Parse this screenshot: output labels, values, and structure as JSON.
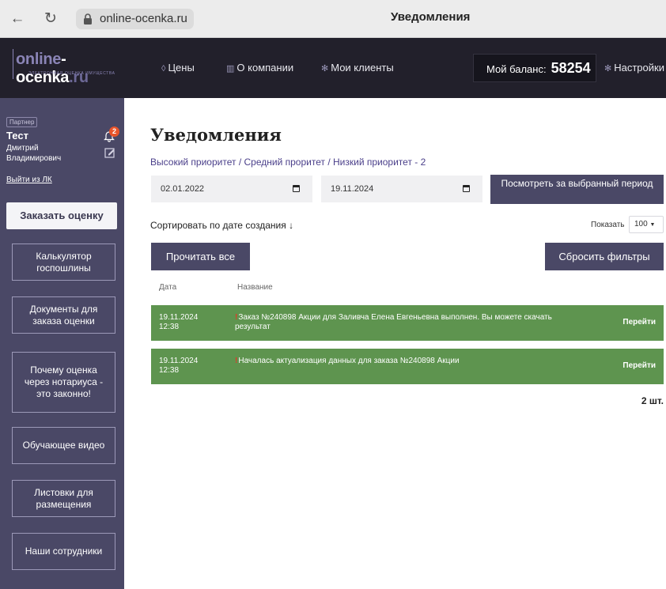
{
  "browser": {
    "url": "online-ocenka.ru",
    "title": "Уведомления"
  },
  "header": {
    "logo_parts": [
      "onl",
      "ine",
      "-ocenka",
      ".ru"
    ],
    "logo_tagline": "ЭЛЕКТРОННАЯ ОЦЕНКА ИМУЩЕСТВА",
    "nav": [
      {
        "label": "Цены",
        "icon": "tag-icon"
      },
      {
        "label": "О компании",
        "icon": "building-icon"
      },
      {
        "label": "Мои клиенты",
        "icon": "clients-icon"
      }
    ],
    "balance_label": "Мой баланс:",
    "balance_value": "58254",
    "settings_label": "Настройки"
  },
  "sidebar": {
    "role_badge": "Партнер",
    "user_name": "Тест",
    "user_patronymic": "Дмитрий Владимирович",
    "notif_count": "2",
    "logout": "Выйти из ЛК",
    "order_button": "Заказать оценку",
    "buttons": [
      "Калькулятор госпошлины",
      "Документы для заказа оценки",
      "Почему оценка через нотариуса - это законно!",
      "Обучающее видео",
      "Листовки для размещения",
      "Наши сотрудники"
    ]
  },
  "main": {
    "title": "Уведомления",
    "priority": {
      "high": "Высокий приоритет",
      "mid": "Средний прориnет",
      "low": "Низкий приоритет - 2",
      "sep": " / "
    },
    "date_from": "02.01.2022",
    "date_to": "19.11.2024",
    "period_button": "Посмотреть за выбранный период",
    "sort_label": "Сортировать по дате создания ↓",
    "show_label": "Показать",
    "show_value": "100",
    "read_all": "Прочитать все",
    "reset_filters": "Сбросить фильтры",
    "col_date": "Дата",
    "col_name": "Название",
    "notifications": [
      {
        "date": "19.11.2024",
        "time": "12:38",
        "mark": "!",
        "text": "Заказ №240898 Акции для Заливча Елена Евгеньевна выполнен. Вы можете скачать результат",
        "action": "Перейти"
      },
      {
        "date": "19.11.2024",
        "time": "12:38",
        "mark": "!",
        "text": "Началась актуализация данных для заказа №240898 Акции",
        "action": "Перейти"
      }
    ],
    "total": "2 шт."
  }
}
